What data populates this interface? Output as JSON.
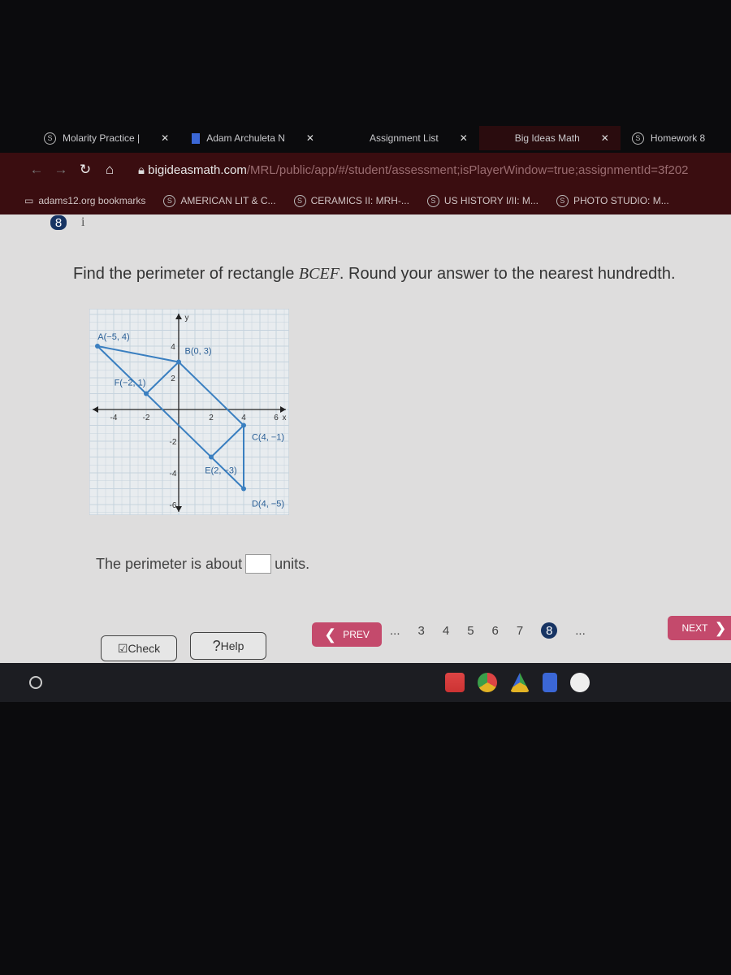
{
  "browser": {
    "tabs": [
      {
        "title": "Molarity Practice |",
        "icon": "schoology-icon"
      },
      {
        "title": "Adam Archuleta  N",
        "icon": "docs-icon"
      },
      {
        "title": "Assignment List",
        "icon": "site-icon"
      },
      {
        "title": "Big Ideas Math",
        "icon": "site-icon",
        "active": true
      },
      {
        "title": "Homework 8",
        "icon": "schoology-icon"
      }
    ],
    "url_host": "bigideasmath.com",
    "url_path": "/MRL/public/app/#/student/assessment;isPlayerWindow=true;assignmentId=3f202",
    "bookmarks": [
      "adams12.org bookmarks",
      "AMERICAN LIT & C...",
      "CERAMICS II: MRH-...",
      "US HISTORY I/II: M...",
      "PHOTO STUDIO: M..."
    ]
  },
  "question": {
    "number": "8",
    "info": "i",
    "prefix": "Find the perimeter of rectangle ",
    "shape": "BCEF",
    "suffix": ". Round your answer to the nearest hundredth."
  },
  "graph": {
    "x_axis_label": "x",
    "y_axis_label": "y",
    "x_ticks": [
      -4,
      -2,
      2,
      4,
      6
    ],
    "y_ticks": [
      4,
      2,
      -2,
      -4,
      -6
    ],
    "points": [
      {
        "name": "A",
        "x": -5,
        "y": 4,
        "label": "A(−5, 4)"
      },
      {
        "name": "B",
        "x": 0,
        "y": 3,
        "label": "B(0, 3)"
      },
      {
        "name": "C",
        "x": 4,
        "y": -1,
        "label": "C(4, −1)"
      },
      {
        "name": "D",
        "x": 4,
        "y": -5,
        "label": "D(4, −5)"
      },
      {
        "name": "E",
        "x": 2,
        "y": -3,
        "label": "E(2, −3)"
      },
      {
        "name": "F",
        "x": -2,
        "y": 1,
        "label": "F(−2, 1)"
      }
    ],
    "segments": [
      [
        "A",
        "B"
      ],
      [
        "B",
        "C"
      ],
      [
        "C",
        "D"
      ],
      [
        "D",
        "A"
      ],
      [
        "B",
        "F"
      ],
      [
        "C",
        "E"
      ]
    ],
    "color": "#3a7fc0"
  },
  "answer": {
    "prefix": "The perimeter is about",
    "value": "",
    "suffix": "units."
  },
  "buttons": {
    "check": "Check",
    "help": "Help",
    "prev": "PREV",
    "next": "NEXT"
  },
  "pager": {
    "pages": [
      "...",
      "3",
      "4",
      "5",
      "6",
      "7",
      "8",
      "..."
    ],
    "current": "8"
  }
}
